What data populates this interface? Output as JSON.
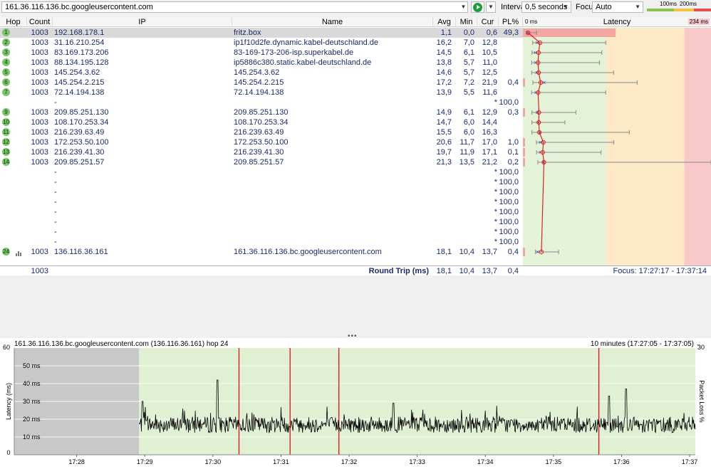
{
  "toolbar": {
    "target": "161.36.116.136.bc.googleusercontent.com",
    "interval_label": "Interval",
    "interval_value": "0,5 seconds",
    "focus_label": "Focus",
    "focus_value": "Auto",
    "scale_100": "100ms",
    "scale_200": "200ms",
    "colors": {
      "good": "#8bc34a",
      "warn": "#f5c242",
      "bad": "#e85050"
    }
  },
  "grid": {
    "columns": {
      "hop": "Hop",
      "count": "Count",
      "ip": "IP",
      "name": "Name",
      "avg": "Avg",
      "min": "Min",
      "cur": "Cur",
      "pl": "PL%",
      "latency": "Latency"
    },
    "latency_min": "0 ms",
    "latency_max": "234 ms",
    "rows": [
      {
        "hop": "1",
        "count": "1003",
        "ip": "192.168.178.1",
        "name": "fritz.box",
        "avg": "1,1",
        "min": "0,0",
        "cur": "0,6",
        "pl": "49,3",
        "latency_avg": 1.1,
        "latency_min": 0.0,
        "latency_max": 12,
        "loss": 49.3
      },
      {
        "hop": "2",
        "count": "1003",
        "ip": "31.16.210.254",
        "name": "ip1f10d2fe.dynamic.kabel-deutschland.de",
        "avg": "16,2",
        "min": "7,0",
        "cur": "12,8",
        "pl": "",
        "latency_avg": 16.2,
        "latency_min": 7.0,
        "latency_max": 100,
        "loss": 0
      },
      {
        "hop": "3",
        "count": "1003",
        "ip": "83.169.173.206",
        "name": "83-169-173-206-isp.superkabel.de",
        "avg": "14,5",
        "min": "6,1",
        "cur": "10,5",
        "pl": "",
        "latency_avg": 14.5,
        "latency_min": 6.1,
        "latency_max": 95,
        "loss": 0
      },
      {
        "hop": "4",
        "count": "1003",
        "ip": "88.134.195.128",
        "name": "ip5886c380.static.kabel-deutschland.de",
        "avg": "13,8",
        "min": "5,7",
        "cur": "11,0",
        "pl": "",
        "latency_avg": 13.8,
        "latency_min": 5.7,
        "latency_max": 92,
        "loss": 0
      },
      {
        "hop": "5",
        "count": "1003",
        "ip": "145.254.3.62",
        "name": "145.254.3.62",
        "avg": "14,6",
        "min": "5,7",
        "cur": "12,5",
        "pl": "",
        "latency_avg": 14.6,
        "latency_min": 5.7,
        "latency_max": 110,
        "loss": 0
      },
      {
        "hop": "6",
        "count": "1003",
        "ip": "145.254.2.215",
        "name": "145.254.2.215",
        "avg": "17,2",
        "min": "7,2",
        "cur": "21,9",
        "pl": "0,4",
        "latency_avg": 17.2,
        "latency_min": 7.2,
        "latency_max": 140,
        "loss": 0.4
      },
      {
        "hop": "7",
        "count": "1003",
        "ip": "72.14.194.138",
        "name": "72.14.194.138",
        "avg": "13,9",
        "min": "5,5",
        "cur": "11,6",
        "pl": "",
        "latency_avg": 13.9,
        "latency_min": 5.5,
        "latency_max": 100,
        "loss": 0
      },
      {
        "hop": "",
        "count": "",
        "ip": "-",
        "name": "",
        "avg": "",
        "min": "",
        "cur": "*",
        "pl": "100,0",
        "latency_avg": null,
        "latency_min": null,
        "latency_max": null,
        "loss": 100
      },
      {
        "hop": "9",
        "count": "1003",
        "ip": "209.85.251.130",
        "name": "209.85.251.130",
        "avg": "14,9",
        "min": "6,1",
        "cur": "12,9",
        "pl": "0,3",
        "latency_avg": 14.9,
        "latency_min": 6.1,
        "latency_max": 62,
        "loss": 0.3
      },
      {
        "hop": "10",
        "count": "1003",
        "ip": "108.170.253.34",
        "name": "108.170.253.34",
        "avg": "14,7",
        "min": "6,0",
        "cur": "14,4",
        "pl": "",
        "latency_avg": 14.7,
        "latency_min": 6.0,
        "latency_max": 48,
        "loss": 0
      },
      {
        "hop": "11",
        "count": "1003",
        "ip": "216.239.63.49",
        "name": "216.239.63.49",
        "avg": "15,5",
        "min": "6,0",
        "cur": "16,3",
        "pl": "",
        "latency_avg": 15.5,
        "latency_min": 6.0,
        "latency_max": 130,
        "loss": 0
      },
      {
        "hop": "12",
        "count": "1003",
        "ip": "172.253.50.100",
        "name": "172.253.50.100",
        "avg": "20,6",
        "min": "11,7",
        "cur": "17,0",
        "pl": "1,0",
        "latency_avg": 20.6,
        "latency_min": 11.7,
        "latency_max": 110,
        "loss": 1.0
      },
      {
        "hop": "13",
        "count": "1003",
        "ip": "216.239.41.30",
        "name": "216.239.41.30",
        "avg": "19,7",
        "min": "11,9",
        "cur": "17,1",
        "pl": "0,1",
        "latency_avg": 19.7,
        "latency_min": 11.9,
        "latency_max": 94,
        "loss": 0.1
      },
      {
        "hop": "14",
        "count": "1003",
        "ip": "209.85.251.57",
        "name": "209.85.251.57",
        "avg": "21,3",
        "min": "13,5",
        "cur": "21,2",
        "pl": "0,2",
        "latency_avg": 21.3,
        "latency_min": 13.5,
        "latency_max": 234,
        "loss": 0.2
      },
      {
        "hop": "",
        "count": "",
        "ip": "-",
        "name": "",
        "avg": "",
        "min": "",
        "cur": "*",
        "pl": "100,0",
        "latency_avg": null,
        "latency_min": null,
        "latency_max": null,
        "loss": 100
      },
      {
        "hop": "",
        "count": "",
        "ip": "-",
        "name": "",
        "avg": "",
        "min": "",
        "cur": "*",
        "pl": "100,0",
        "latency_avg": null,
        "latency_min": null,
        "latency_max": null,
        "loss": 100
      },
      {
        "hop": "",
        "count": "",
        "ip": "-",
        "name": "",
        "avg": "",
        "min": "",
        "cur": "*",
        "pl": "100,0",
        "latency_avg": null,
        "latency_min": null,
        "latency_max": null,
        "loss": 100
      },
      {
        "hop": "",
        "count": "",
        "ip": "-",
        "name": "",
        "avg": "",
        "min": "",
        "cur": "*",
        "pl": "100,0",
        "latency_avg": null,
        "latency_min": null,
        "latency_max": null,
        "loss": 100
      },
      {
        "hop": "",
        "count": "",
        "ip": "-",
        "name": "",
        "avg": "",
        "min": "",
        "cur": "*",
        "pl": "100,0",
        "latency_avg": null,
        "latency_min": null,
        "latency_max": null,
        "loss": 100
      },
      {
        "hop": "",
        "count": "",
        "ip": "-",
        "name": "",
        "avg": "",
        "min": "",
        "cur": "*",
        "pl": "100,0",
        "latency_avg": null,
        "latency_min": null,
        "latency_max": null,
        "loss": 100
      },
      {
        "hop": "",
        "count": "",
        "ip": "-",
        "name": "",
        "avg": "",
        "min": "",
        "cur": "*",
        "pl": "100,0",
        "latency_avg": null,
        "latency_min": null,
        "latency_max": null,
        "loss": 100
      },
      {
        "hop": "",
        "count": "",
        "ip": "-",
        "name": "",
        "avg": "",
        "min": "",
        "cur": "*",
        "pl": "100,0",
        "latency_avg": null,
        "latency_min": null,
        "latency_max": null,
        "loss": 100
      },
      {
        "hop": "24",
        "count": "1003",
        "ip": "136.116.36.161",
        "name": "161.36.116.136.bc.googleusercontent.com",
        "avg": "18,1",
        "min": "10,4",
        "cur": "13,7",
        "pl": "0,4",
        "latency_avg": 18.1,
        "latency_min": 10.4,
        "latency_max": 40,
        "loss": 0.4
      }
    ],
    "round_trip": {
      "count": "1003",
      "label": "Round Trip (ms)",
      "avg": "18,1",
      "min": "10,4",
      "cur": "13,7",
      "pl": "0,4"
    },
    "focus_range": "Focus: 17:27:17 - 17:37:14"
  },
  "chart": {
    "title": "161.36.116.136.bc.googleusercontent.com (136.116.36.161) hop 24",
    "range": "10 minutes (17:27:05 - 17:37:05)",
    "ylabel": "Latency (ms)",
    "y2label": "Packet Loss %",
    "ymax_label": "60",
    "ymin_label": "0",
    "y2max_label": "30",
    "gridlines": [
      "50 ms",
      "40 ms",
      "30 ms",
      "20 ms",
      "10 ms"
    ],
    "xticks": [
      "17:28",
      "17:29",
      "17:30",
      "17:31",
      "17:32",
      "17:33",
      "17:34",
      "17:35",
      "17:36",
      "17:37"
    ]
  },
  "chart_data": {
    "type": "line",
    "title": "161.36.116.136.bc.googleusercontent.com (136.116.36.161) hop 24",
    "xlabel": "",
    "ylabel": "Latency (ms)",
    "y2label": "Packet Loss %",
    "ylim": [
      0,
      60
    ],
    "y2lim": [
      0,
      30
    ],
    "x_range": [
      "17:27:05",
      "17:37:05"
    ],
    "no_data_until": "17:28:55",
    "mean_latency": 18.1,
    "min_latency": 10.4,
    "spikes": [
      {
        "time": "17:30:04",
        "latency": 42
      },
      {
        "time": "17:36:04",
        "latency": 37
      },
      {
        "time": "17:35:49",
        "latency": 33
      },
      {
        "time": "17:28:58",
        "latency": 30
      },
      {
        "time": "17:32:39",
        "latency": 29
      }
    ],
    "packet_loss_events": [
      "17:30:23",
      "17:31:08",
      "17:31:51",
      "17:35:40"
    ]
  }
}
